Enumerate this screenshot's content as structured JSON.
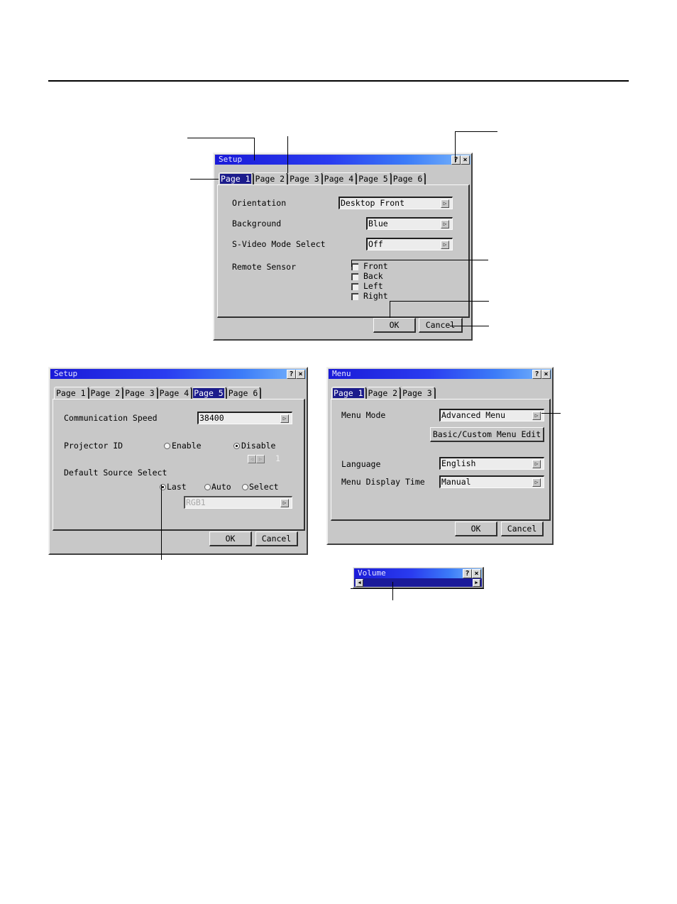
{
  "setup_page1": {
    "title": "Setup",
    "help_icon": "question-mark",
    "close_icon": "x",
    "tabs": [
      {
        "label": "Page 1",
        "active": true
      },
      {
        "label": "Page 2",
        "active": false
      },
      {
        "label": "Page 3",
        "active": false
      },
      {
        "label": "Page 4",
        "active": false
      },
      {
        "label": "Page 5",
        "active": false
      },
      {
        "label": "Page 6",
        "active": false
      }
    ],
    "orientation": {
      "label": "Orientation",
      "value": "Desktop Front"
    },
    "background": {
      "label": "Background",
      "value": "Blue"
    },
    "svideo": {
      "label": "S-Video Mode Select",
      "value": "Off"
    },
    "remote_sensor": {
      "label": "Remote Sensor",
      "options": [
        {
          "label": "Front",
          "checked": false
        },
        {
          "label": "Back",
          "checked": false
        },
        {
          "label": "Left",
          "checked": false
        },
        {
          "label": "Right",
          "checked": false
        }
      ]
    },
    "ok_label": "OK",
    "cancel_label": "Cancel"
  },
  "setup_page5": {
    "title": "Setup",
    "tabs": [
      {
        "label": "Page 1",
        "active": false
      },
      {
        "label": "Page 2",
        "active": false
      },
      {
        "label": "Page 3",
        "active": false
      },
      {
        "label": "Page 4",
        "active": false
      },
      {
        "label": "Page 5",
        "active": true
      },
      {
        "label": "Page 6",
        "active": false
      }
    ],
    "comm_speed": {
      "label": "Communication Speed",
      "value": "38400"
    },
    "projector_id": {
      "label": "Projector ID",
      "enable_label": "Enable",
      "disable_label": "Disable",
      "selected": "Disable",
      "id_value": "1"
    },
    "default_source": {
      "label": "Default Source Select",
      "options": [
        "Last",
        "Auto",
        "Select"
      ],
      "selected": "Last",
      "source_value": "RGB1"
    },
    "ok_label": "OK",
    "cancel_label": "Cancel"
  },
  "menu_dialog": {
    "title": "Menu",
    "tabs": [
      {
        "label": "Page 1",
        "active": true
      },
      {
        "label": "Page 2",
        "active": false
      },
      {
        "label": "Page 3",
        "active": false
      }
    ],
    "menu_mode": {
      "label": "Menu Mode",
      "value": "Advanced Menu"
    },
    "edit_button": "Basic/Custom Menu Edit",
    "language": {
      "label": "Language",
      "value": "English"
    },
    "display_time": {
      "label": "Menu Display Time",
      "value": "Manual"
    },
    "ok_label": "OK",
    "cancel_label": "Cancel"
  },
  "volume_bar": {
    "title": "Volume",
    "left_arrow": "◀",
    "right_arrow": "▶"
  },
  "glyphs": {
    "help": "?",
    "close": "×",
    "combo_arrow": "▷",
    "spin_left": "◁",
    "spin_right": "▷"
  }
}
